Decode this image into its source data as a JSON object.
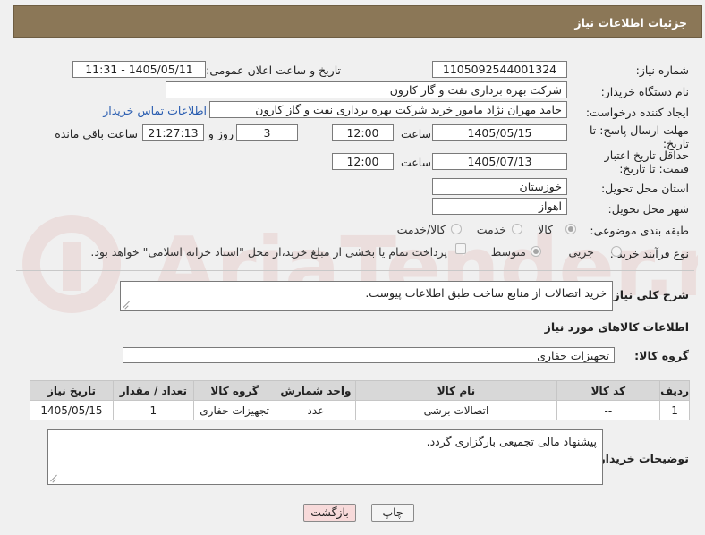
{
  "page": {
    "title": "جزئیات اطلاعات نیاز"
  },
  "labels": {
    "need_number": "شماره نیاز:",
    "announce_datetime": "تاریخ و ساعت اعلان عمومی:",
    "buyer_org": "نام دستگاه خریدار:",
    "requester": "ایجاد کننده درخواست:",
    "reply_deadline": "مهلت ارسال پاسخ: تا تاریخ:",
    "price_validity": "حداقل تاریخ اعتبار قیمت: تا تاریخ:",
    "time": "ساعت",
    "days_and": "روز و",
    "hours_remaining": "ساعت باقی مانده",
    "province": "استان محل تحویل:",
    "city": "شهر محل تحویل:",
    "category": "طبقه بندی موضوعی:",
    "process_type": "نوع فرآیند خرید :",
    "description": "شرح کلي نياز:",
    "goods_info": "اطلاعات کالاهای مورد نیاز",
    "goods_group": "گروه کالا:",
    "buyer_notes": "توضیحات خریدار:"
  },
  "values": {
    "need_number": "1105092544001324",
    "announce_datetime": "1405/05/11 - 11:31",
    "buyer_org": "شرکت بهره برداری نفت و گاز کارون",
    "requester": "حامد مهران نژاد مامور خرید شرکت بهره برداری نفت و گاز کارون",
    "contact_link": "اطلاعات تماس خریدار",
    "reply_date": "1405/05/15",
    "reply_time": "12:00",
    "reply_days": "3",
    "reply_remaining": "21:27:13",
    "validity_date": "1405/07/13",
    "validity_time": "12:00",
    "province": "خوزستان",
    "city": "اهواز",
    "description": "خرید اتصالات از منابع ساخت طبق اطلاعات پیوست.",
    "goods_group": "تجهیزات حفاری",
    "buyer_notes": "پیشنهاد مالی تجمیعی بارگزاری گردد."
  },
  "category_options": [
    {
      "label": "کالا",
      "selected": true
    },
    {
      "label": "خدمت",
      "selected": false
    },
    {
      "label": "کالا/خدمت",
      "selected": false
    }
  ],
  "process_options": [
    {
      "label": "جزیی",
      "selected": false
    },
    {
      "label": "متوسط",
      "selected": true
    }
  ],
  "payment_note": "پرداخت تمام یا بخشی از مبلغ خرید،از محل \"اسناد خزانه اسلامی\" خواهد بود.",
  "table": {
    "headers": [
      "ردیف",
      "کد کالا",
      "نام کالا",
      "واحد شمارش",
      "گروه کالا",
      "تعداد / مقدار",
      "تاریخ نیاز"
    ],
    "rows": [
      [
        "1",
        "--",
        "اتصالات برشی",
        "عدد",
        "تجهیزات حفاری",
        "1",
        "1405/05/15"
      ]
    ]
  },
  "buttons": {
    "print": "چاپ",
    "back": "بازگشت"
  },
  "watermark": "AriaTender.neT",
  "colors": {
    "header_bg": "#8b7757",
    "link": "#2a5db0",
    "back_button_bg": "#f7dada",
    "watermark": "#c0392b"
  }
}
